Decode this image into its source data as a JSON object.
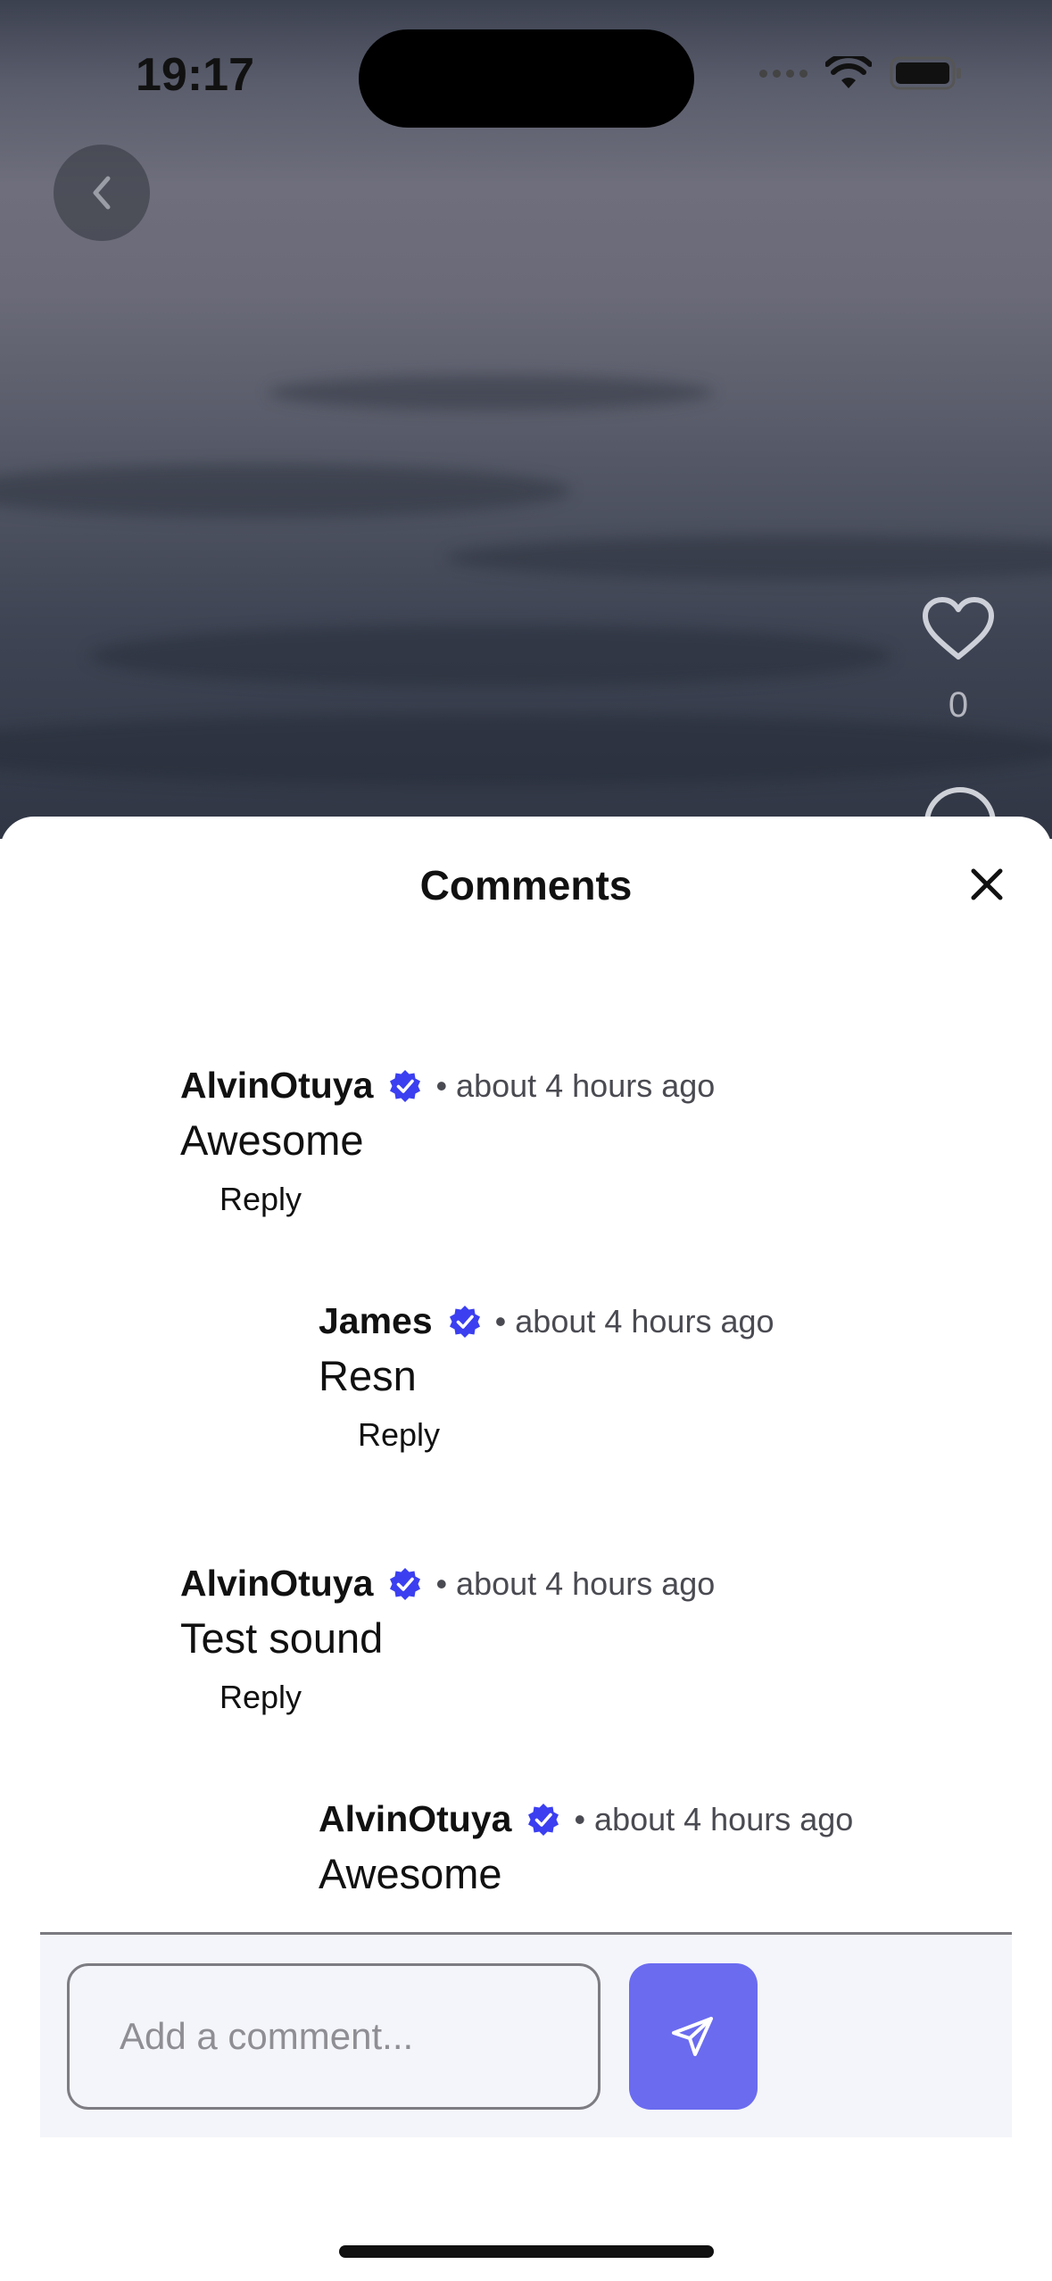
{
  "status_bar": {
    "time": "19:17"
  },
  "video": {
    "like_count": "0"
  },
  "sheet": {
    "title": "Comments",
    "comments": [
      {
        "user": "AlvinOtuya",
        "time": "• about 4 hours ago",
        "text": "Awesome",
        "reply_label": "Reply"
      },
      {
        "user": "James",
        "time": "• about 4 hours ago",
        "text": "Resn",
        "reply_label": "Reply"
      },
      {
        "user": "AlvinOtuya",
        "time": "• about 4 hours ago",
        "text": "Test sound",
        "reply_label": "Reply"
      },
      {
        "user": "AlvinOtuya",
        "time": "• about 4 hours ago",
        "text": "Awesome",
        "reply_label": ""
      }
    ],
    "input": {
      "placeholder": "Add a comment...",
      "value": ""
    }
  },
  "icons": {
    "back": "chevron-left-icon",
    "like": "heart-icon",
    "comment": "comment-bubble-icon",
    "close": "close-icon",
    "verified": "verified-badge-icon",
    "send": "send-icon"
  },
  "colors": {
    "accent": "#6b6bf0",
    "verified": "#3b3ff0",
    "input_bar_bg": "#f4f5fa"
  }
}
